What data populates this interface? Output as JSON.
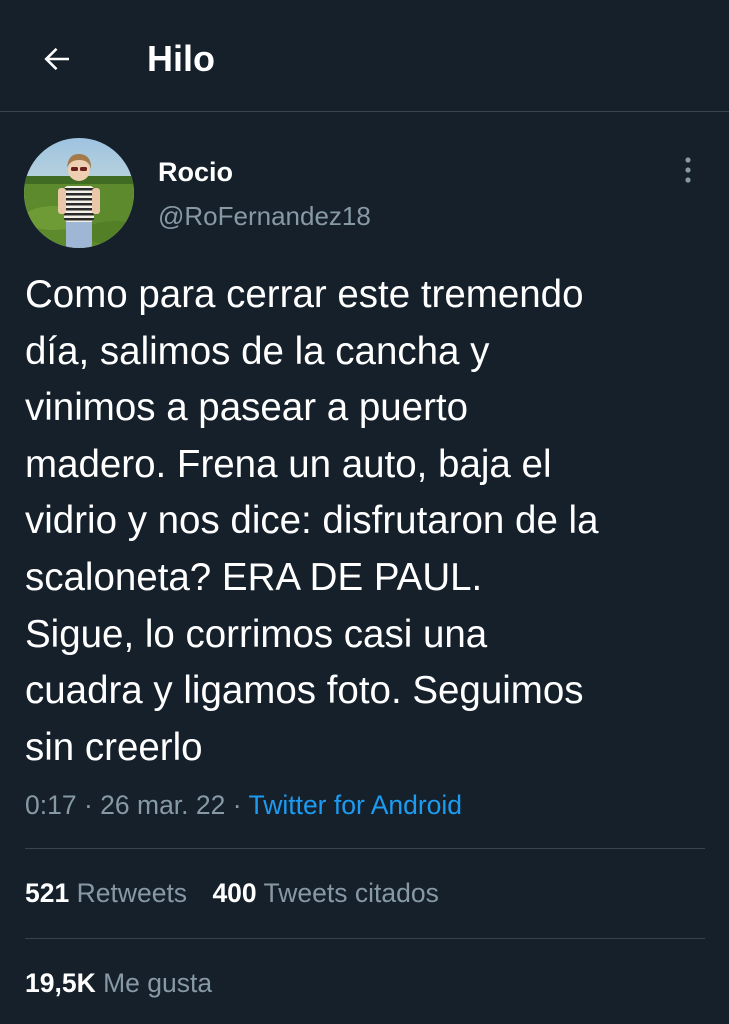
{
  "header": {
    "title": "Hilo"
  },
  "tweet": {
    "author_name": "Rocio",
    "handle": "@RoFernandez18",
    "text": "Como para cerrar este tremendo\ndía, salimos de la cancha y\nvinimos a pasear a puerto\nmadero. Frena un auto, baja el\nvidrio y nos dice: disfrutaron de la\nscaloneta? ERA DE PAUL.\nSigue, lo corrimos casi una\ncuadra y ligamos foto. Seguimos\nsin creerlo",
    "time": "0:17",
    "separator": "·",
    "date": "26 mar. 22",
    "source": "Twitter for Android"
  },
  "stats": {
    "retweets_count": "521",
    "retweets_label": "Retweets",
    "quotes_count": "400",
    "quotes_label": "Tweets citados",
    "likes_count": "19,5K",
    "likes_label": "Me gusta"
  },
  "colors": {
    "background": "#15202b",
    "divider": "#38444d",
    "secondary_text": "#8899a6",
    "link": "#1d9bf0"
  },
  "icons": {
    "back": "arrow-left-icon",
    "more": "more-vertical-icon"
  }
}
